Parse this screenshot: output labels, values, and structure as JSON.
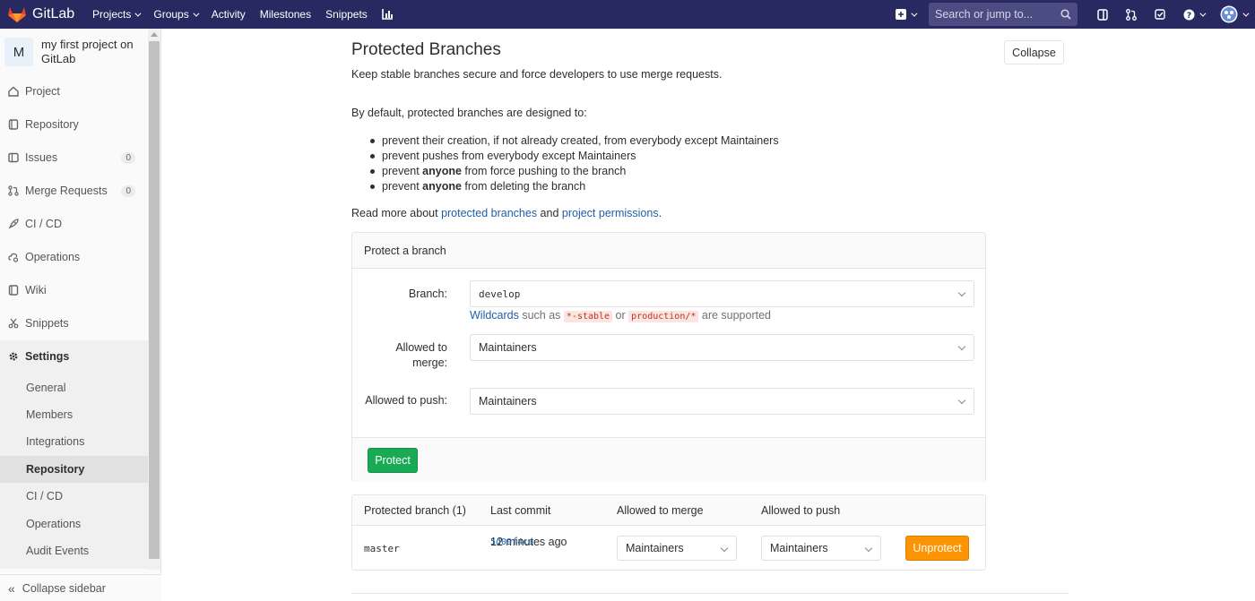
{
  "navbar": {
    "brand": "GitLab",
    "items": [
      {
        "label": "Projects",
        "dropdown": true
      },
      {
        "label": "Groups",
        "dropdown": true
      },
      {
        "label": "Activity",
        "dropdown": false
      },
      {
        "label": "Milestones",
        "dropdown": false
      },
      {
        "label": "Snippets",
        "dropdown": false
      }
    ],
    "search_placeholder": "Search or jump to..."
  },
  "sidebar": {
    "project_avatar": "M",
    "project_name": "my first project on GitLab",
    "items": [
      {
        "label": "Project",
        "icon": "home-icon"
      },
      {
        "label": "Repository",
        "icon": "book-icon"
      },
      {
        "label": "Issues",
        "icon": "issues-icon",
        "count": "0"
      },
      {
        "label": "Merge Requests",
        "icon": "merge-request-icon",
        "count": "0"
      },
      {
        "label": "CI / CD",
        "icon": "rocket-icon"
      },
      {
        "label": "Operations",
        "icon": "cloud-gear-icon"
      },
      {
        "label": "Wiki",
        "icon": "book-icon"
      },
      {
        "label": "Snippets",
        "icon": "scissors-icon"
      },
      {
        "label": "Settings",
        "icon": "gear-icon"
      }
    ],
    "settings_sub": [
      "General",
      "Members",
      "Integrations",
      "Repository",
      "CI / CD",
      "Operations",
      "Audit Events"
    ],
    "active_sub": "Repository",
    "collapse_label": "Collapse sidebar"
  },
  "main": {
    "title": "Protected Branches",
    "subtitle": "Keep stable branches secure and force developers to use merge requests.",
    "collapse_label": "Collapse",
    "intro": "By default, protected branches are designed to:",
    "bullets": [
      {
        "pre": "prevent their creation, if not already created, from everybody except Maintainers",
        "bold": "",
        "post": ""
      },
      {
        "pre": "prevent pushes from everybody except Maintainers",
        "bold": "",
        "post": ""
      },
      {
        "pre": "prevent ",
        "bold": "anyone",
        "post": " from force pushing to the branch"
      },
      {
        "pre": "prevent ",
        "bold": "anyone",
        "post": " from deleting the branch"
      }
    ],
    "readmore": {
      "pre": "Read more about ",
      "link1": "protected branches",
      "mid": " and ",
      "link2": "project permissions",
      "post": "."
    }
  },
  "protect_form": {
    "header": "Protect a branch",
    "branch_label": "Branch:",
    "branch_value": "develop",
    "help_link": "Wildcards",
    "help_mid": " such as ",
    "help_code1": "*-stable",
    "help_or": " or ",
    "help_code2": "production/*",
    "help_post": " are supported",
    "merge_label": "Allowed to merge:",
    "merge_value": "Maintainers",
    "push_label": "Allowed to push:",
    "push_value": "Maintainers",
    "submit_label": "Protect"
  },
  "protected_table": {
    "headers": [
      "Protected branch (1)",
      "Last commit",
      "Allowed to merge",
      "Allowed to push"
    ],
    "rows": [
      {
        "branch": "master",
        "sha": "5d09f4ca",
        "time": " 12 minutes ago",
        "merge": "Maintainers",
        "push": "Maintainers",
        "action": "Unprotect"
      }
    ]
  },
  "colors": {
    "navbar": "#292961",
    "protect": "#1aaa55",
    "unprotect": "#fc9403",
    "link": "#1f5fa9"
  }
}
